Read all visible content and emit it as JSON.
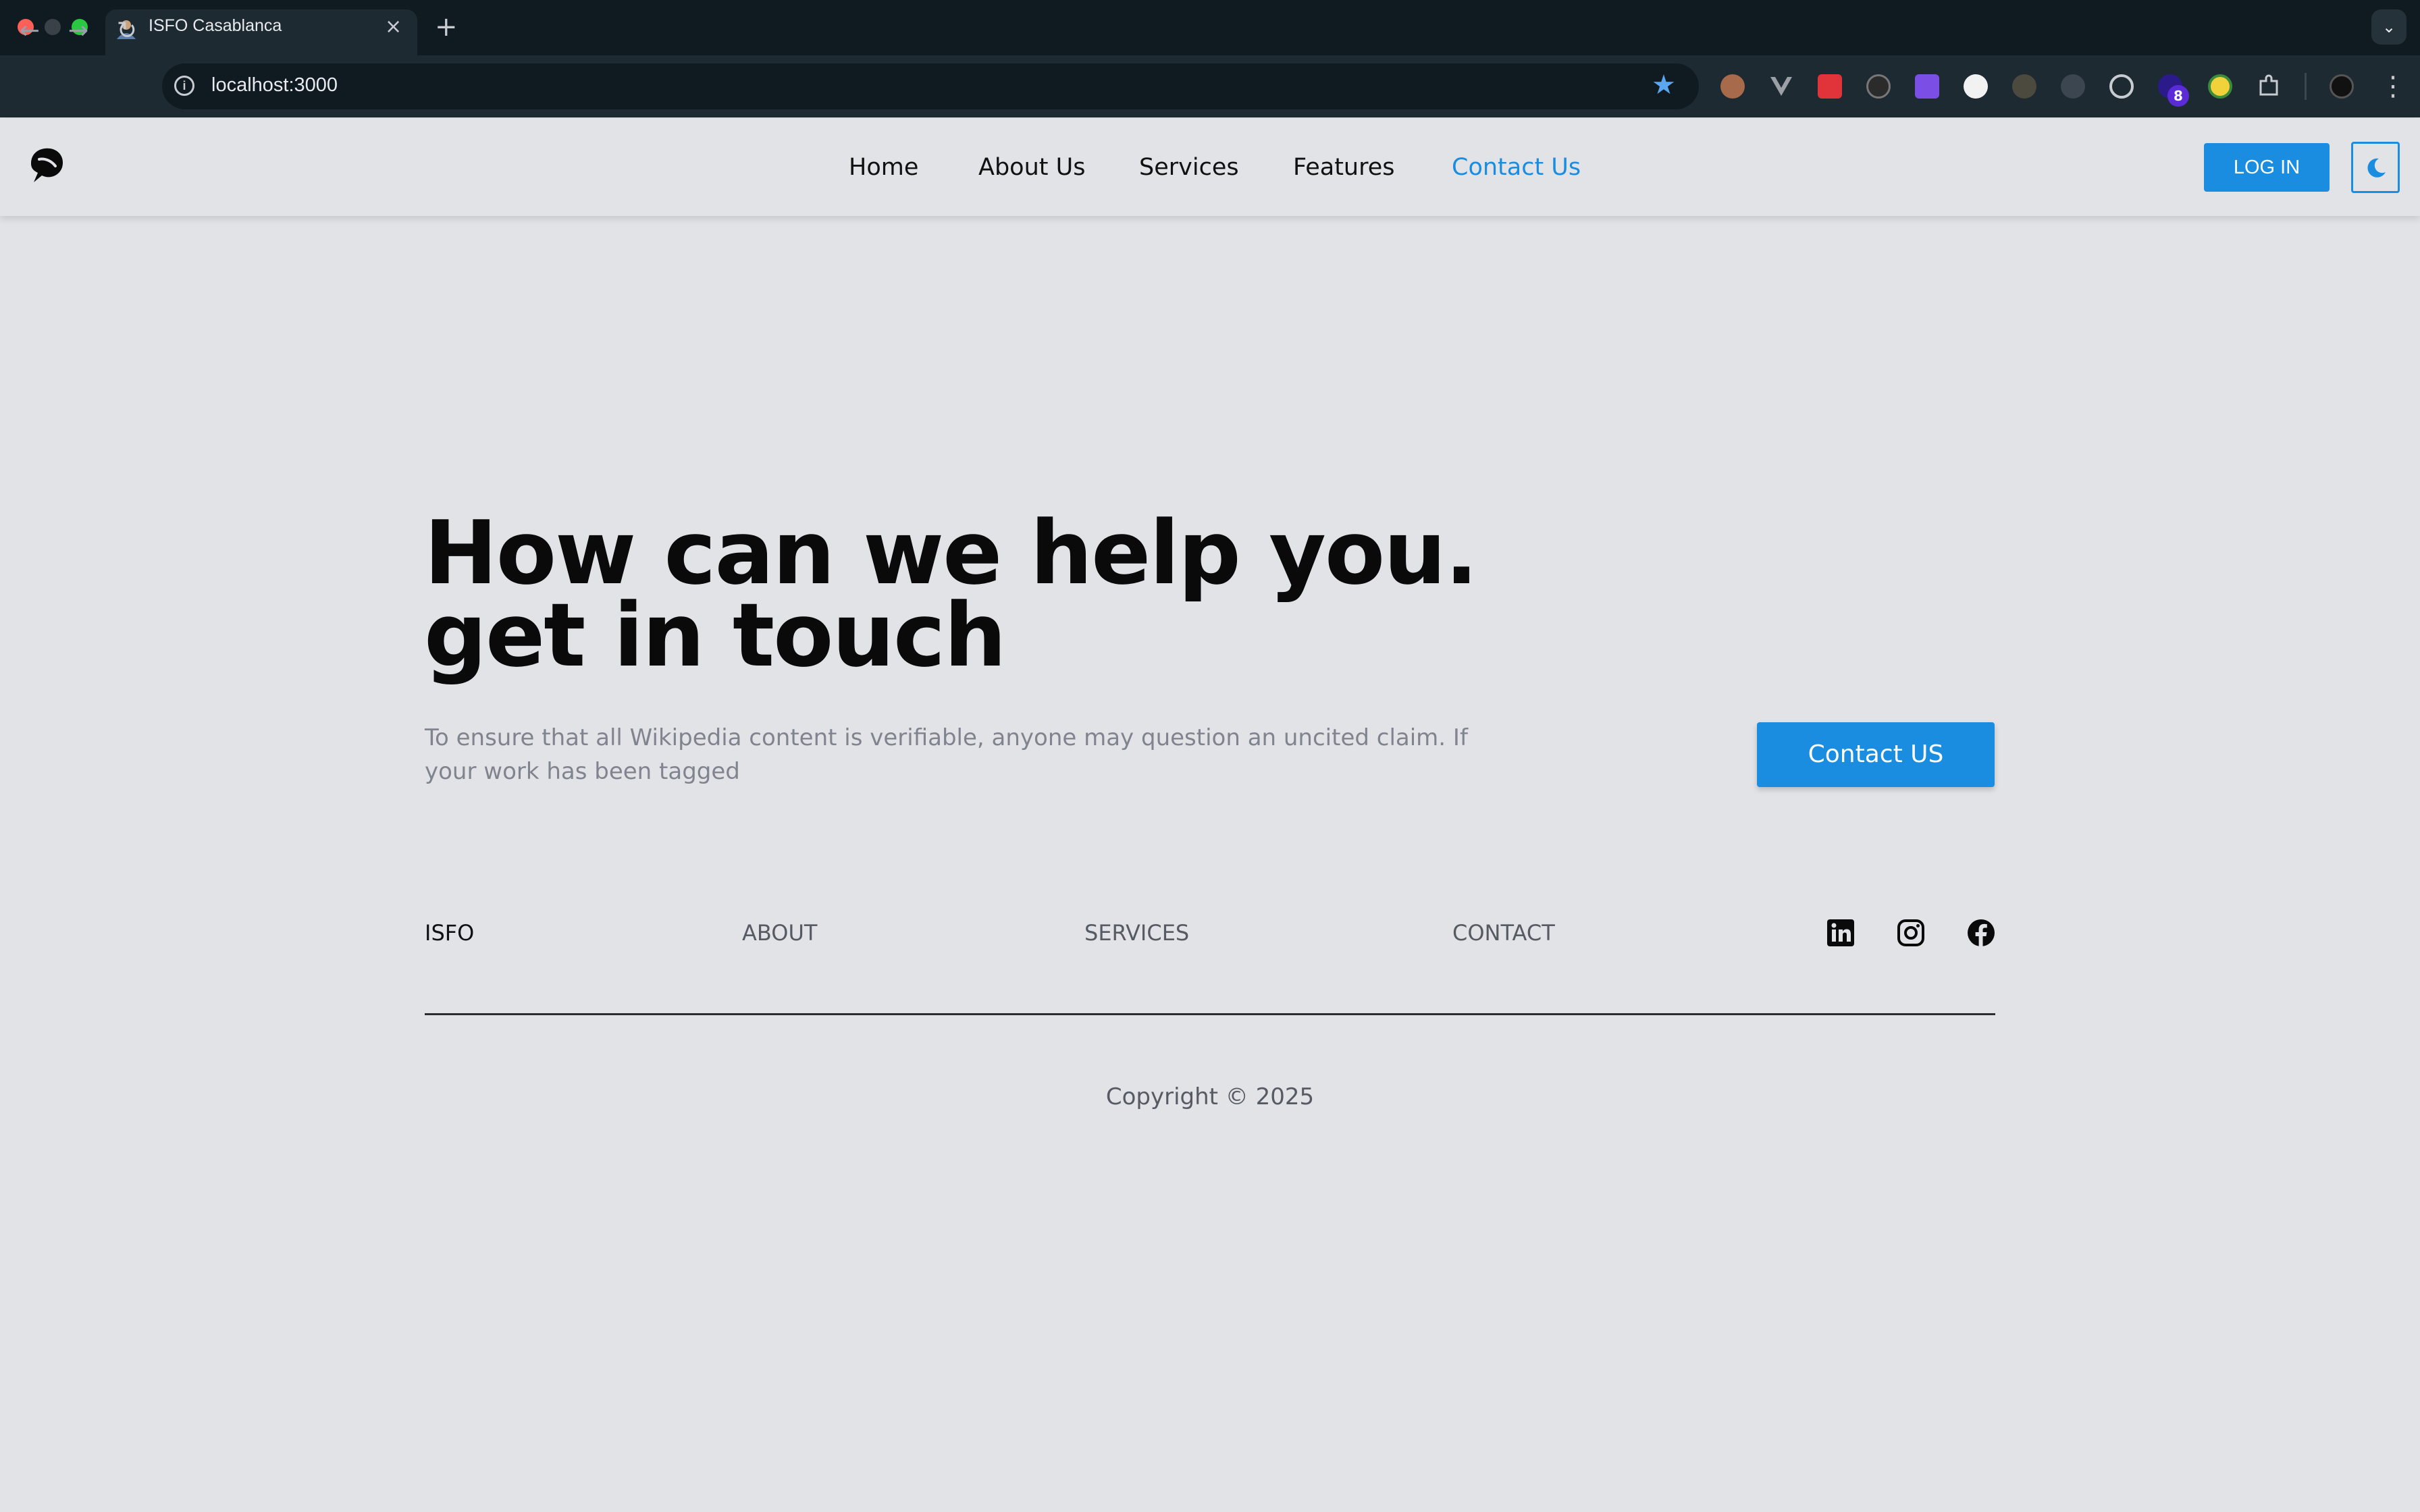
{
  "browser": {
    "tab_title": "ISFO Casablanca",
    "tab_close": "×",
    "new_tab": "+",
    "url": "localhost:3000",
    "extension_badge_count": "8"
  },
  "header": {
    "nav": [
      {
        "label": "Home",
        "active": false
      },
      {
        "label": "About Us",
        "active": false
      },
      {
        "label": "Services",
        "active": false
      },
      {
        "label": "Features",
        "active": false
      },
      {
        "label": "Contact Us",
        "active": true
      }
    ],
    "login_label": "LOG IN"
  },
  "hero": {
    "title": "How can we help you. get in touch",
    "text": "To ensure that all Wikipedia content is verifiable, anyone may question an uncited claim. If your work has been tagged",
    "button_label": "Contact US"
  },
  "footer": {
    "brand": "ISFO",
    "links": [
      "ABOUT",
      "SERVICES",
      "CONTACT"
    ],
    "social": [
      "linkedin-icon",
      "instagram-icon",
      "facebook-icon"
    ],
    "copyright": "Copyright © 2025"
  },
  "colors": {
    "accent": "#1a8de0",
    "background": "#e2e3e7",
    "text": "#0a0a0a",
    "muted": "#80848f"
  }
}
